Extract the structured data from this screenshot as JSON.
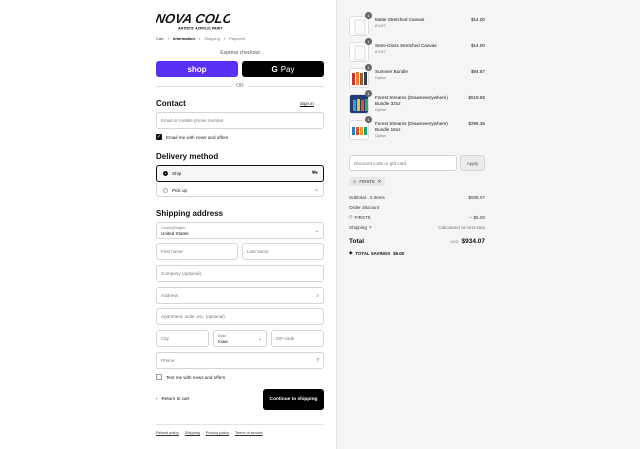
{
  "brand": {
    "name": "NOVA COLOR",
    "tagline": "ARTISTS' ACRYLIC PAINT"
  },
  "breadcrumb": [
    "Cart",
    "Information",
    "Shipping",
    "Payment"
  ],
  "express": {
    "label": "Express checkout",
    "shop_label": "shop",
    "gpay_label": "Pay",
    "or_label": "OR"
  },
  "contact": {
    "title": "Contact",
    "signin": "Sign in",
    "email_placeholder": "Email or mobile phone number",
    "news_label": "Email me with news and offers"
  },
  "delivery": {
    "title": "Delivery method",
    "options": [
      {
        "label": "Ship"
      },
      {
        "label": "Pick up"
      }
    ]
  },
  "shipping": {
    "title": "Shipping address",
    "country_label": "Country/Region",
    "country_value": "United States",
    "first_name": "First name",
    "last_name": "Last name",
    "company": "Company (optional)",
    "address": "Address",
    "apartment": "Apartment, suite, etc. (optional)",
    "city": "City",
    "state_label": "State",
    "state_value": "Iowa",
    "zip": "ZIP code",
    "phone": "Phone",
    "text_label": "Text me with news and offers"
  },
  "actions": {
    "return_label": "Return to cart",
    "continue_label": "Continue to shipping"
  },
  "footer": [
    "Refund policy",
    "Shipping",
    "Privacy policy",
    "Terms of service"
  ],
  "cart": {
    "items": [
      {
        "qty": "1",
        "name": "Matte Stretched Canvas",
        "sub": "8\"x10\"",
        "price": "$14.00"
      },
      {
        "qty": "1",
        "name": "Semi-Gloss Stretched Canvas",
        "sub": "8\"x10\"",
        "price": "$14.00"
      },
      {
        "qty": "1",
        "name": "Summer Bundle",
        "sub": "Option",
        "price": "$94.87"
      },
      {
        "qty": "1",
        "name": "Forest Streams (Drawneverywhere) Bundle 32oz",
        "sub": "Option",
        "price": "$519.85"
      },
      {
        "qty": "1",
        "name": "Forest Streams (Drawneverywhere) Bundle 16oz",
        "sub": "Option",
        "price": "$296.35"
      }
    ],
    "discount_placeholder": "Discount code or gift card",
    "apply_label": "Apply",
    "applied_code": "FIRST5",
    "subtotal_label": "Subtotal · 5 items",
    "subtotal_value": "$939.07",
    "order_discount_label": "Order discount",
    "discount_code_label": "FIRST5",
    "discount_value": "– $5.00",
    "shipping_label": "Shipping",
    "shipping_value": "Calculated at next step",
    "total_label": "Total",
    "currency": "USD",
    "total_value": "$934.07",
    "savings_label": "TOTAL SAVINGS",
    "savings_value": "$5.00"
  },
  "colors": {
    "shop": "#5a31f4",
    "dark": "#000000",
    "panel": "#f5f5f5"
  }
}
